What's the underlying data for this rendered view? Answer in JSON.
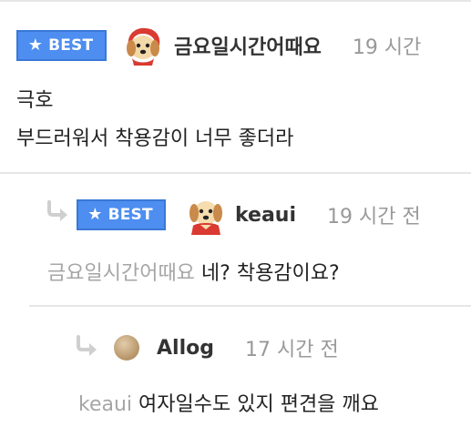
{
  "comments": [
    {
      "badge": "BEST",
      "author": "금요일시간어때요",
      "time": "19 시간",
      "lines": [
        "극호",
        "부드러워서 착용감이 너무 좋더라"
      ]
    },
    {
      "badge": "BEST",
      "author": "keaui",
      "time": "19 시간 전",
      "mention": "금요일시간어때요",
      "text": "네? 착용감이요?"
    },
    {
      "author": "Allog",
      "time": "17 시간 전",
      "mention": "keaui",
      "text": "여자일수도 있지 편견을 깨요"
    }
  ],
  "icons": {
    "badge_star": "star-icon",
    "reply_arrow": "reply-arrow-icon",
    "avatar_1": "puppy-red-hood-avatar",
    "avatar_2": "puppy-red-cape-avatar",
    "avatar_3": "plain-circle-avatar"
  },
  "colors": {
    "badge_bg": "#4d8ef0",
    "badge_border": "#3a78d8",
    "author": "#333333",
    "time": "#999999",
    "mention": "#a6a6a6",
    "separator": "#e6e6e6"
  }
}
